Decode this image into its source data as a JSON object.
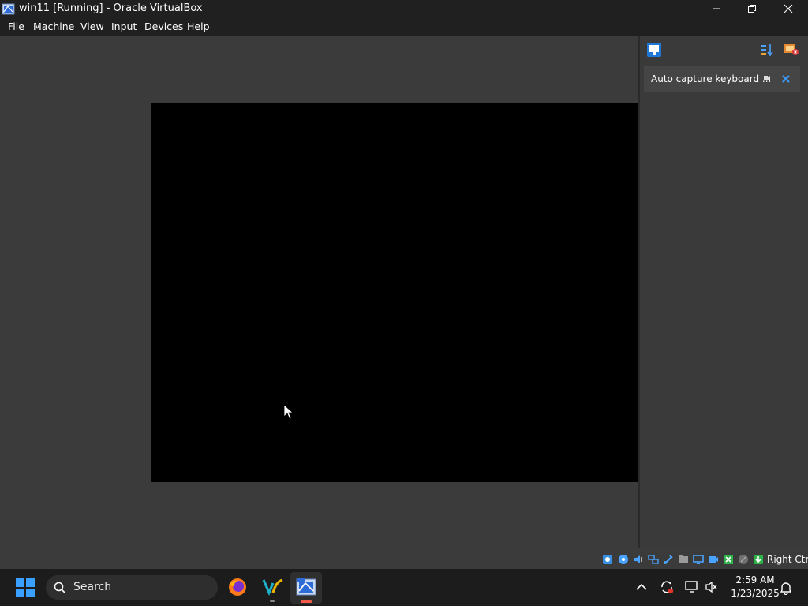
{
  "window": {
    "title": "win11 [Running] - Oracle VirtualBox"
  },
  "menu": {
    "items": [
      "File",
      "Machine",
      "View",
      "Input",
      "Devices",
      "Help"
    ]
  },
  "notification": {
    "text": "Auto capture keyboard ..."
  },
  "statusbar": {
    "icons": [
      "hard-disk-icon",
      "optical-drive-icon",
      "audio-icon",
      "network-icon",
      "usb-icon",
      "shared-folders-icon",
      "display-icon",
      "recording-icon",
      "cpu-icon",
      "mouse-integration-icon",
      "keyboard-icon"
    ],
    "host_key": "Right Ctrl"
  },
  "taskbar": {
    "search_label": "Search",
    "time": "2:59 AM",
    "date": "1/23/2025"
  },
  "colors": {
    "accent": "#0a84ff",
    "titlebar": "#202020",
    "background": "#3b3b3b",
    "guest": "#000000"
  }
}
